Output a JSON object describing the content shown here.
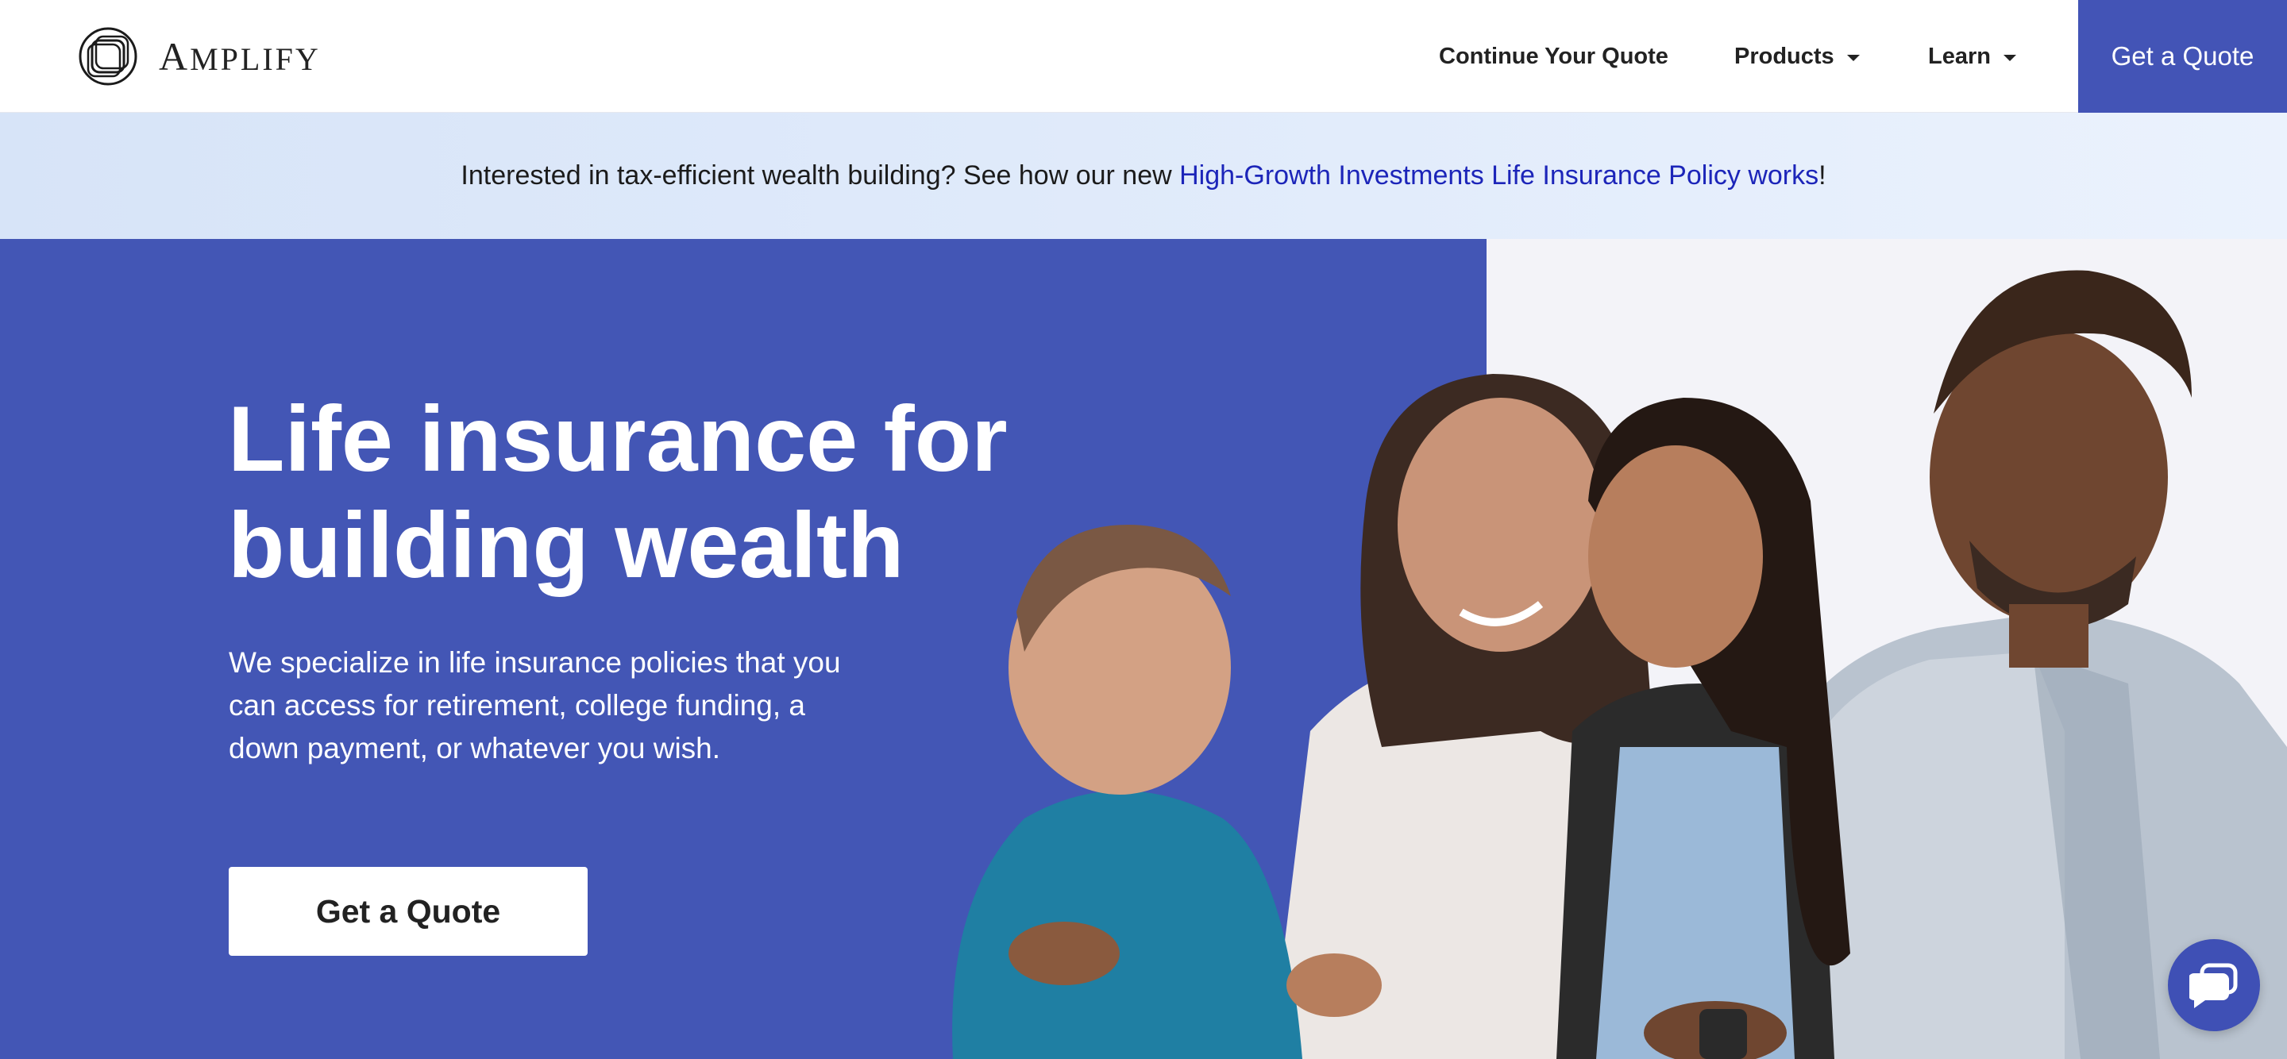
{
  "header": {
    "logo_text": "AMPLIFY",
    "logo_initial": "A",
    "logo_rest": "MPLIFY",
    "nav": {
      "continue_label": "Continue Your Quote",
      "products_label": "Products",
      "learn_label": "Learn"
    },
    "cta_label": "Get a Quote"
  },
  "banner": {
    "text_before": "Interested in tax-efficient wealth building? See how our new ",
    "link_text": "High-Growth Investments Life Insurance Policy works",
    "text_after": "!"
  },
  "hero": {
    "title_line1": "Life insurance for",
    "title_line2": "building wealth",
    "subtitle_line1": "We specialize in life insurance policies that you",
    "subtitle_line2": "can access for retirement, college funding, a",
    "subtitle_line3": "down payment, or whatever you wish.",
    "cta_label": "Get a Quote"
  },
  "colors": {
    "brand_blue": "#4356b5",
    "link_blue": "#1c25b9",
    "banner_bg": "#dfe9fa"
  },
  "icons": {
    "logo": "amplify-logo-icon",
    "dropdown": "caret-down-icon",
    "chat": "chat-bubble-icon"
  }
}
